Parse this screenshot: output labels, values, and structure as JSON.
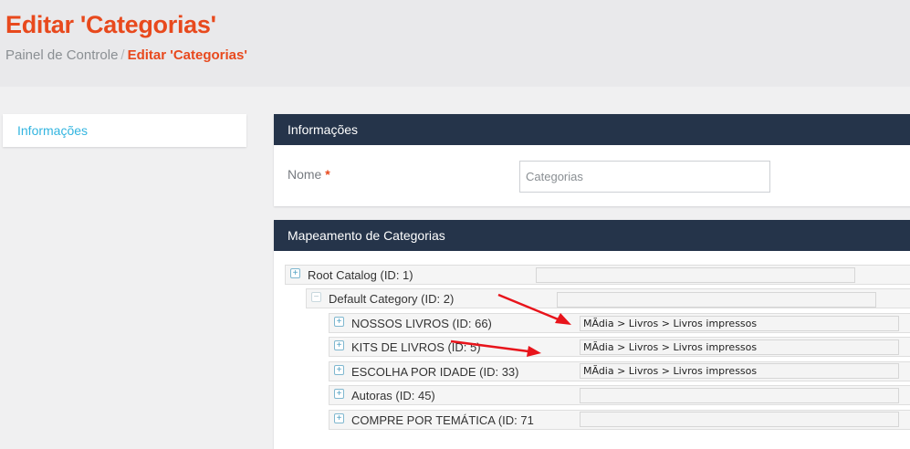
{
  "header": {
    "title": "Editar 'Categorias'",
    "breadcrumb": {
      "root": "Painel de Controle",
      "separator": "/",
      "current": "Editar 'Categorias'"
    }
  },
  "sidebar": {
    "tab_label": "Informações"
  },
  "info_panel": {
    "title": "Informações",
    "name_label": "Nome",
    "required_mark": "*",
    "name_value": "Categorias"
  },
  "mapping_panel": {
    "title": "Mapeamento de Categorias",
    "tree": [
      {
        "label": "Root Catalog (ID: 1)",
        "mapping": "",
        "expander": "plus"
      },
      {
        "label": "Default Category (ID: 2)",
        "mapping": "",
        "expander": "minus"
      },
      {
        "label": "NOSSOS LIVROS (ID: 66)",
        "mapping": "MÃdia > Livros > Livros impressos",
        "expander": "plus"
      },
      {
        "label": "KITS DE LIVROS (ID: 5)",
        "mapping": "MÃdia > Livros > Livros impressos",
        "expander": "plus"
      },
      {
        "label": "ESCOLHA POR IDADE (ID: 33)",
        "mapping": "MÃdia > Livros > Livros impressos",
        "expander": "plus"
      },
      {
        "label": "Autoras (ID: 45)",
        "mapping": "",
        "expander": "plus"
      },
      {
        "label": "COMPRE POR TEMÁTICA (ID: 71)",
        "mapping": "",
        "expander": "plus"
      }
    ]
  },
  "icons": {
    "expand": "plus-square-icon",
    "collapse": "minus-square-icon",
    "annotation": "red-arrow-icon"
  },
  "colors": {
    "accent": "#e8491d",
    "panel_header": "#25344a",
    "link": "#33b5e0",
    "annotation_arrow": "#e8141b"
  }
}
